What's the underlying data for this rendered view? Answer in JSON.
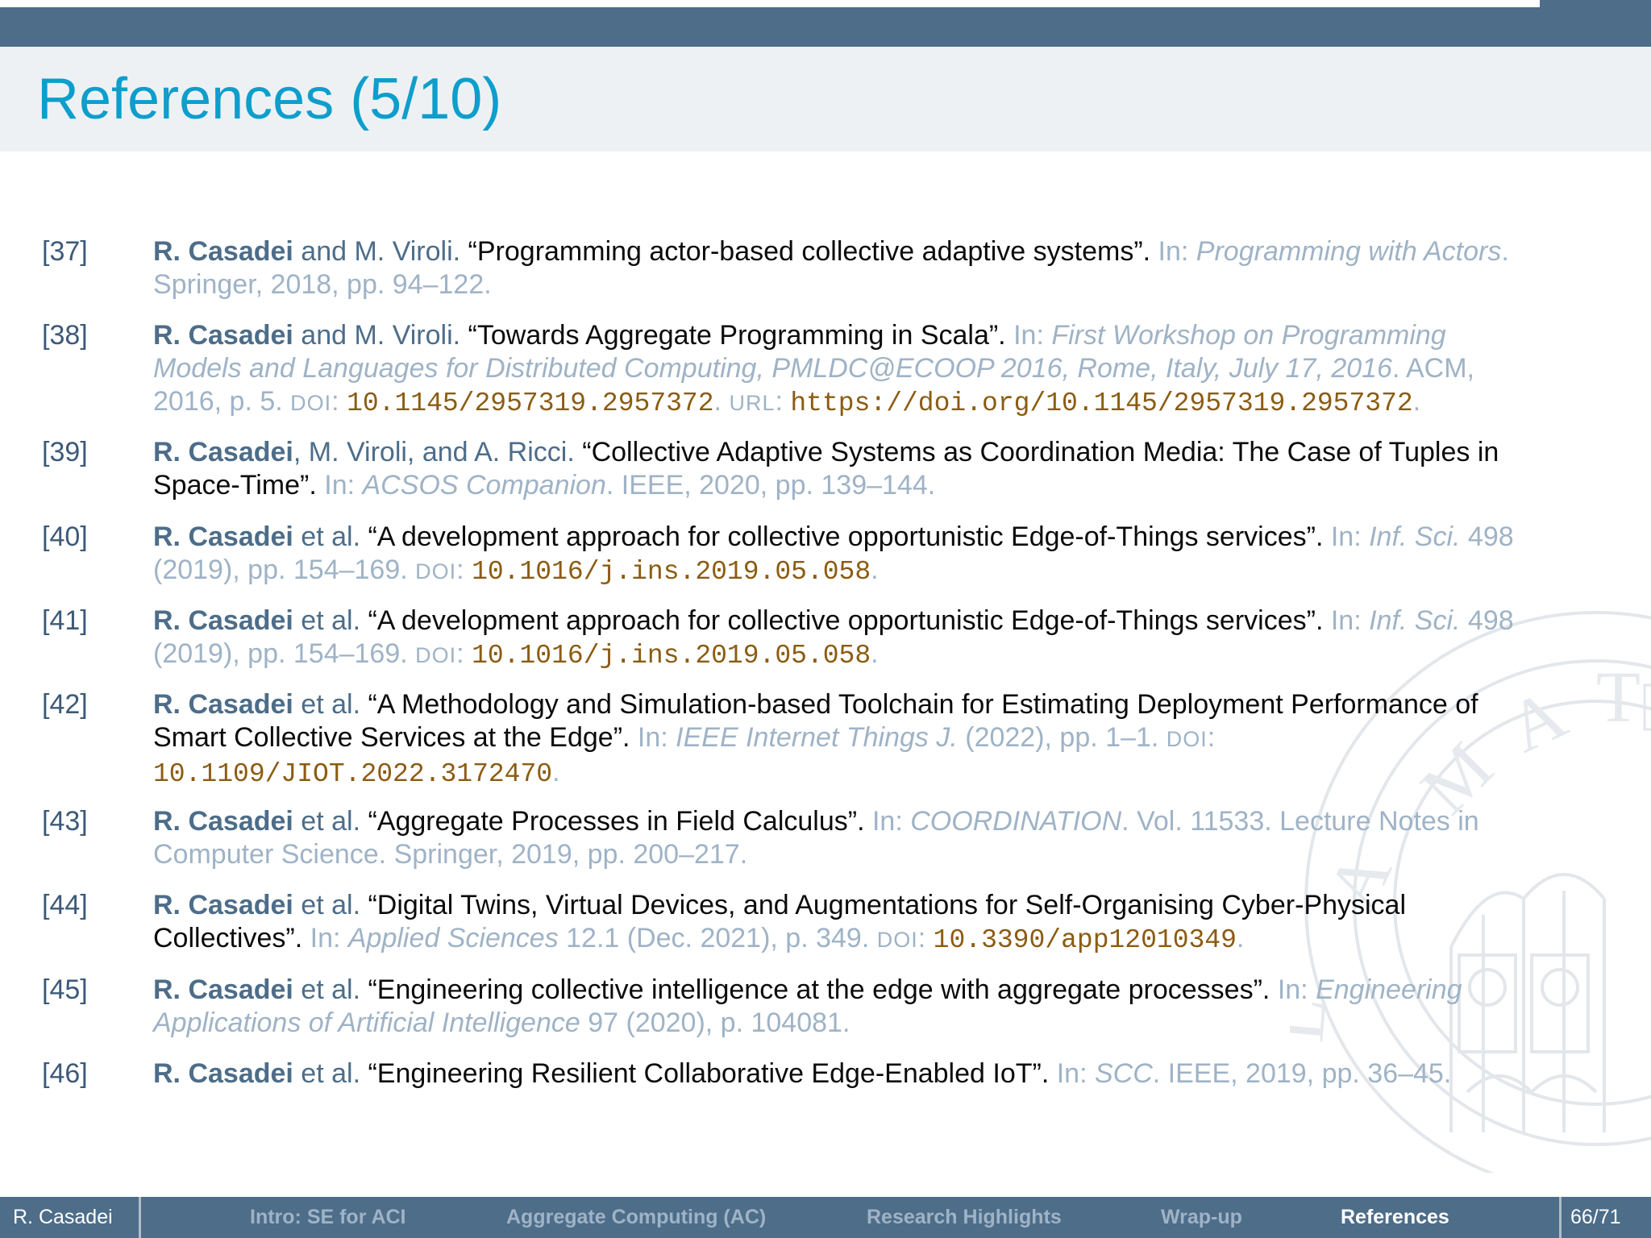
{
  "slide": {
    "title": "References (5/10)"
  },
  "references": [
    {
      "num": "[37]",
      "lines": [
        [
          [
            "au-bold",
            "R. Casadei"
          ],
          [
            "au",
            " and M. Viroli. "
          ],
          [
            "ttl",
            "“Programming actor-based collective adaptive systems”."
          ],
          [
            "",
            " In: "
          ],
          [
            "ven",
            "Programming with Actors"
          ],
          [
            "",
            "."
          ]
        ],
        [
          [
            "",
            "Springer, 2018, pp. 94–122."
          ]
        ]
      ]
    },
    {
      "num": "[38]",
      "lines": [
        [
          [
            "au-bold",
            "R. Casadei"
          ],
          [
            "au",
            " and M. Viroli. "
          ],
          [
            "ttl",
            "“Towards Aggregate Programming in Scala”."
          ],
          [
            "",
            " In: "
          ],
          [
            "ven",
            "First Workshop on Programming"
          ]
        ],
        [
          [
            "ven",
            "Models and Languages for Distributed Computing, PMLDC@ECOOP 2016, Rome, Italy, July 17, 2016"
          ],
          [
            "",
            ". ACM,"
          ]
        ],
        [
          [
            "",
            "2016, p. 5. "
          ],
          [
            "sc",
            "DOI"
          ],
          [
            "",
            ": "
          ],
          [
            "mono",
            "10.1145/2957319.2957372"
          ],
          [
            "",
            ". "
          ],
          [
            "sc",
            "URL"
          ],
          [
            "",
            ": "
          ],
          [
            "mono",
            "https://doi.org/10.1145/2957319.2957372"
          ],
          [
            "",
            "."
          ]
        ]
      ]
    },
    {
      "num": "[39]",
      "lines": [
        [
          [
            "au-bold",
            "R. Casadei"
          ],
          [
            "au",
            ", M. Viroli, and A. Ricci. "
          ],
          [
            "ttl",
            "“Collective Adaptive Systems as Coordination Media: The Case of Tuples in"
          ]
        ],
        [
          [
            "ttl",
            "Space-Time”."
          ],
          [
            "",
            " In: "
          ],
          [
            "ven",
            "ACSOS Companion"
          ],
          [
            "",
            ". IEEE, 2020, pp. 139–144."
          ]
        ]
      ]
    },
    {
      "num": "[40]",
      "lines": [
        [
          [
            "au-bold",
            "R. Casadei"
          ],
          [
            "au",
            " et al. "
          ],
          [
            "ttl",
            "“A development approach for collective opportunistic Edge-of-Things services”."
          ],
          [
            "",
            " In: "
          ],
          [
            "ven",
            "Inf. Sci."
          ],
          [
            "",
            " 498"
          ]
        ],
        [
          [
            "",
            "(2019), pp. 154–169. "
          ],
          [
            "sc",
            "DOI"
          ],
          [
            "",
            ": "
          ],
          [
            "mono",
            "10.1016/j.ins.2019.05.058"
          ],
          [
            "",
            "."
          ]
        ]
      ]
    },
    {
      "num": "[41]",
      "lines": [
        [
          [
            "au-bold",
            "R. Casadei"
          ],
          [
            "au",
            " et al. "
          ],
          [
            "ttl",
            "“A development approach for collective opportunistic Edge-of-Things services”."
          ],
          [
            "",
            " In: "
          ],
          [
            "ven",
            "Inf. Sci."
          ],
          [
            "",
            " 498"
          ]
        ],
        [
          [
            "",
            "(2019), pp. 154–169. "
          ],
          [
            "sc",
            "DOI"
          ],
          [
            "",
            ": "
          ],
          [
            "mono",
            "10.1016/j.ins.2019.05.058"
          ],
          [
            "",
            "."
          ]
        ]
      ]
    },
    {
      "num": "[42]",
      "lines": [
        [
          [
            "au-bold",
            "R. Casadei"
          ],
          [
            "au",
            " et al. "
          ],
          [
            "ttl",
            "“A Methodology and Simulation-based Toolchain for Estimating Deployment Performance of"
          ]
        ],
        [
          [
            "ttl",
            "Smart Collective Services at the Edge”."
          ],
          [
            "",
            " In: "
          ],
          [
            "ven",
            "IEEE Internet Things J."
          ],
          [
            "",
            " (2022), pp. 1–1. "
          ],
          [
            "sc",
            "DOI"
          ],
          [
            "",
            ":"
          ]
        ],
        [
          [
            "mono",
            "10.1109/JIOT.2022.3172470"
          ],
          [
            "",
            "."
          ]
        ]
      ]
    },
    {
      "num": "[43]",
      "lines": [
        [
          [
            "au-bold",
            "R. Casadei"
          ],
          [
            "au",
            " et al. "
          ],
          [
            "ttl",
            "“Aggregate Processes in Field Calculus”."
          ],
          [
            "",
            " In: "
          ],
          [
            "ven",
            "COORDINATION"
          ],
          [
            "",
            ". Vol. 11533. Lecture Notes in"
          ]
        ],
        [
          [
            "",
            "Computer Science. Springer, 2019, pp. 200–217."
          ]
        ]
      ]
    },
    {
      "num": "[44]",
      "lines": [
        [
          [
            "au-bold",
            "R. Casadei"
          ],
          [
            "au",
            " et al. "
          ],
          [
            "ttl",
            "“Digital Twins, Virtual Devices, and Augmentations for Self-Organising Cyber-Physical"
          ]
        ],
        [
          [
            "ttl",
            "Collectives”."
          ],
          [
            "",
            " In: "
          ],
          [
            "ven",
            "Applied Sciences"
          ],
          [
            "",
            " 12.1 (Dec. 2021), p. 349. "
          ],
          [
            "sc",
            "DOI"
          ],
          [
            "",
            ": "
          ],
          [
            "mono",
            "10.3390/app12010349"
          ],
          [
            "",
            "."
          ]
        ]
      ]
    },
    {
      "num": "[45]",
      "lines": [
        [
          [
            "au-bold",
            "R. Casadei"
          ],
          [
            "au",
            " et al. "
          ],
          [
            "ttl",
            "“Engineering collective intelligence at the edge with aggregate processes”."
          ],
          [
            "",
            " In: "
          ],
          [
            "ven",
            "Engineering"
          ]
        ],
        [
          [
            "ven",
            "Applications of Artificial Intelligence"
          ],
          [
            "",
            " 97 (2020), p. 104081."
          ]
        ]
      ]
    },
    {
      "num": "[46]",
      "lines": [
        [
          [
            "au-bold",
            "R. Casadei"
          ],
          [
            "au",
            " et al. "
          ],
          [
            "ttl",
            "“Engineering Resilient Collaborative Edge-Enabled IoT”."
          ],
          [
            "",
            " In: "
          ],
          [
            "ven",
            "SCC"
          ],
          [
            "",
            ". IEEE, 2019, pp. 36–45."
          ]
        ]
      ]
    }
  ],
  "footer": {
    "author": "R. Casadei",
    "sections": [
      "Intro: SE for ACI",
      "Aggregate Computing (AC)",
      "Research Highlights",
      "Wrap-up",
      "References"
    ],
    "active_section": "References",
    "page": "66/71"
  },
  "colors": {
    "bar": "#4d6d89",
    "title": "#0d9ecc",
    "ref_number": "#3d5a78",
    "mono": "#8b5c12"
  }
}
